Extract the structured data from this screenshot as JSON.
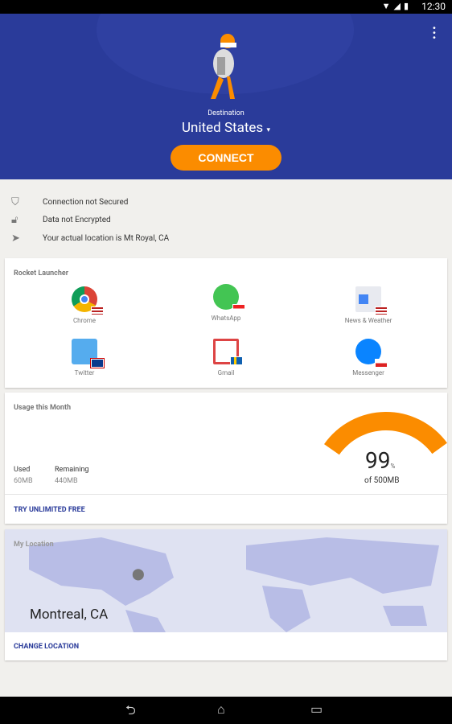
{
  "status_bar": {
    "time": "12:30"
  },
  "header": {
    "destination_label": "Destination",
    "destination_value": "United States",
    "connect_label": "CONNECT"
  },
  "status": [
    {
      "icon": "shield-off-icon",
      "text": "Connection not Secured"
    },
    {
      "icon": "lock-off-icon",
      "text": "Data not Encrypted"
    },
    {
      "icon": "location-arrow-icon",
      "text": "Your actual location is Mt Royal, CA"
    }
  ],
  "launcher": {
    "title": "Rocket Launcher",
    "apps": [
      {
        "name": "Chrome",
        "flag": "US"
      },
      {
        "name": "WhatsApp",
        "flag": "SG"
      },
      {
        "name": "News & Weather",
        "flag": "US"
      },
      {
        "name": "Twitter",
        "flag": "UK"
      },
      {
        "name": "Gmail",
        "flag": "SE"
      },
      {
        "name": "Messenger",
        "flag": "CZ"
      }
    ]
  },
  "usage": {
    "title": "Usage this Month",
    "used_label": "Used",
    "used_value": "60MB",
    "remaining_label": "Remaining",
    "remaining_value": "440MB",
    "percent": "99",
    "percent_sign": "%",
    "total": "of 500MB",
    "cta": "TRY UNLIMITED FREE",
    "accent": "#fb8c00"
  },
  "location": {
    "title": "My Location",
    "city": "Montreal, CA",
    "cta": "CHANGE LOCATION"
  }
}
